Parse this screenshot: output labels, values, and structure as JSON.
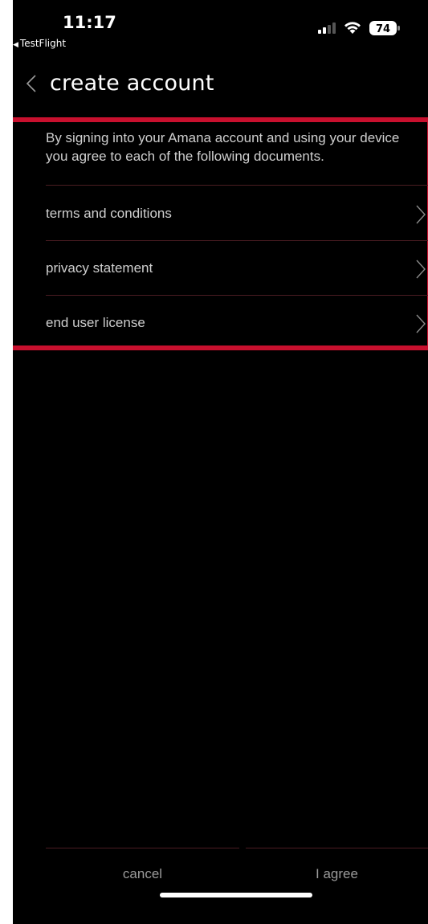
{
  "status_bar": {
    "time": "11:17",
    "back_app": "TestFlight",
    "battery": "74"
  },
  "nav": {
    "title": "create account"
  },
  "intro": "By signing into your Amana account and using your device\nyou agree to each of the following documents.",
  "documents": [
    {
      "label": "terms and conditions"
    },
    {
      "label": "privacy statement"
    },
    {
      "label": "end user license"
    }
  ],
  "buttons": {
    "cancel": "cancel",
    "agree": "I agree"
  },
  "colors": {
    "background": "#000000",
    "highlight": "#c8102e",
    "divider": "#4a1c22",
    "text": "#cfcfcf"
  }
}
